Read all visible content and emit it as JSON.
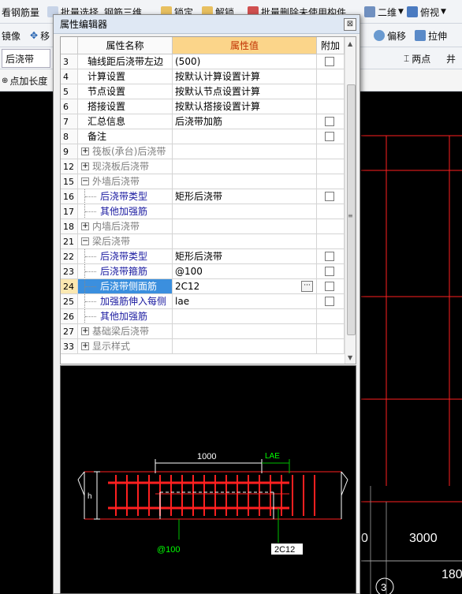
{
  "toolbar1": {
    "items": [
      "看钢筋量",
      "批量选择",
      "钢筋三维",
      "锁定",
      "解锁",
      "批量删除未使用构件",
      "二维",
      "俯视"
    ]
  },
  "toolbar2": {
    "items": [
      "镜像",
      "移",
      "偏移",
      "拉伸"
    ]
  },
  "toolbar3": {
    "combo": "后浇带",
    "items": [
      "两点",
      "井"
    ]
  },
  "toolbar4": {
    "items": [
      "点加长度"
    ]
  },
  "dialog": {
    "title": "属性编辑器",
    "close": "⊠"
  },
  "grid": {
    "headers": [
      "属性名称",
      "属性值",
      "附加"
    ],
    "rows": [
      {
        "num": "3",
        "name": "轴线距后浇带左边",
        "value": "(500)",
        "chk": true,
        "style": "normal",
        "indent": 1
      },
      {
        "num": "4",
        "name": "计算设置",
        "value": "按默认计算设置计算",
        "chk": false,
        "style": "normal",
        "indent": 1
      },
      {
        "num": "5",
        "name": "节点设置",
        "value": "按默认节点设置计算",
        "chk": false,
        "style": "normal",
        "indent": 1
      },
      {
        "num": "6",
        "name": "搭接设置",
        "value": "按默认搭接设置计算",
        "chk": false,
        "style": "normal",
        "indent": 1
      },
      {
        "num": "7",
        "name": "汇总信息",
        "value": "后浇带加筋",
        "chk": true,
        "style": "normal",
        "indent": 1
      },
      {
        "num": "8",
        "name": "备注",
        "value": "",
        "chk": true,
        "style": "normal",
        "indent": 1
      },
      {
        "num": "9",
        "name": "筏板(承台)后浇带",
        "value": "",
        "chk": false,
        "style": "group",
        "exp": "+"
      },
      {
        "num": "12",
        "name": "现浇板后浇带",
        "value": "",
        "chk": false,
        "style": "group",
        "exp": "+"
      },
      {
        "num": "15",
        "name": "外墙后浇带",
        "value": "",
        "chk": false,
        "style": "group",
        "exp": "−"
      },
      {
        "num": "16",
        "name": "后浇带类型",
        "value": "矩形后浇带",
        "chk": true,
        "style": "child",
        "indent": 2
      },
      {
        "num": "17",
        "name": "其他加强筋",
        "value": "",
        "chk": false,
        "style": "child",
        "indent": 2
      },
      {
        "num": "18",
        "name": "内墙后浇带",
        "value": "",
        "chk": false,
        "style": "group",
        "exp": "+"
      },
      {
        "num": "21",
        "name": "梁后浇带",
        "value": "",
        "chk": false,
        "style": "group",
        "exp": "−"
      },
      {
        "num": "22",
        "name": "后浇带类型",
        "value": "矩形后浇带",
        "chk": true,
        "style": "child",
        "indent": 2
      },
      {
        "num": "23",
        "name": "后浇带箍筋",
        "value": "@100",
        "chk": true,
        "style": "child",
        "indent": 2
      },
      {
        "num": "24",
        "name": "后浇带侧面筋",
        "value": "2C12",
        "chk": true,
        "style": "selected",
        "indent": 2
      },
      {
        "num": "25",
        "name": "加强筋伸入每侧",
        "value": "lae",
        "chk": true,
        "style": "child",
        "indent": 2
      },
      {
        "num": "26",
        "name": "其他加强筋",
        "value": "",
        "chk": false,
        "style": "child",
        "indent": 2
      },
      {
        "num": "27",
        "name": "基础梁后浇带",
        "value": "",
        "chk": false,
        "style": "group",
        "exp": "+"
      },
      {
        "num": "33",
        "name": "显示样式",
        "value": "",
        "chk": false,
        "style": "group",
        "exp": "+"
      }
    ]
  },
  "preview": {
    "dim_width": "1000",
    "lae_label": "LAE",
    "h_label": "h",
    "stirrup_label": "@100",
    "side_bar_label": "2C12"
  },
  "canvas": {
    "labels": [
      "0",
      "3000",
      "180",
      "3"
    ]
  },
  "colors": {
    "accent": "#3b8fde",
    "cad_red": "#ff2020",
    "cad_green": "#00c000",
    "blue_text": "#1a1aa0"
  }
}
